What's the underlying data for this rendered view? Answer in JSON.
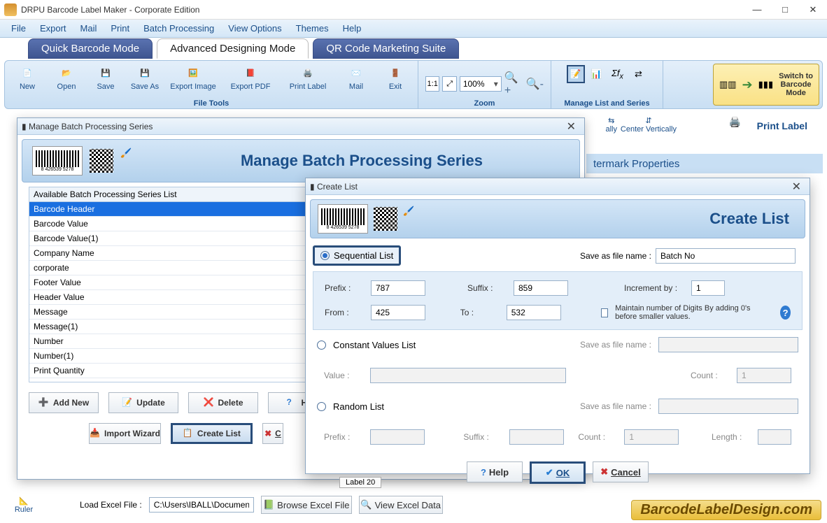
{
  "app": {
    "title": "DRPU Barcode Label Maker - Corporate Edition"
  },
  "menu": [
    "File",
    "Export",
    "Mail",
    "Print",
    "Batch Processing",
    "View Options",
    "Themes",
    "Help"
  ],
  "modes": {
    "quick": "Quick Barcode Mode",
    "advanced": "Advanced Designing Mode",
    "qr": "QR Code Marketing Suite"
  },
  "ribbon": {
    "file": {
      "new": "New",
      "open": "Open",
      "save": "Save",
      "saveas": "Save As",
      "exportimg": "Export Image",
      "exportpdf": "Export PDF",
      "printlabel": "Print Label",
      "mail": "Mail",
      "exit": "Exit",
      "caption": "File Tools"
    },
    "zoom": {
      "caption": "Zoom",
      "value": "100%"
    },
    "series": {
      "caption": "Manage List and Series"
    },
    "switch": {
      "line1": "Switch to",
      "line2": "Barcode",
      "line3": "Mode"
    },
    "center_v": "Center Vertically",
    "center_h_suffix": "ally",
    "print_label": "Print Label"
  },
  "props_strip": "termark Properties",
  "batch": {
    "title": "Manage Batch Processing Series",
    "header": "Manage Batch Processing Series",
    "list_header": "Available Batch Processing Series List",
    "items": [
      "Barcode Header",
      "Barcode Value",
      "Barcode Value(1)",
      "Company Name",
      "corporate",
      "Footer Value",
      "Header Value",
      "Message",
      "Message(1)",
      "Number",
      "Number(1)",
      "Print Quantity"
    ],
    "buttons": {
      "add": "Add New",
      "update": "Update",
      "delete": "Delete",
      "help": "Help",
      "import": "Import Wizard",
      "create": "Create List",
      "cancel_char": "C"
    }
  },
  "create": {
    "title": "Create List",
    "header": "Create List",
    "seq_label": "Sequential List",
    "save_label": "Save as file name :",
    "filename": "Batch No",
    "prefix_l": "Prefix :",
    "prefix": "787",
    "suffix_l": "Suffix :",
    "suffix": "859",
    "inc_l": "Increment by :",
    "inc": "1",
    "from_l": "From :",
    "from": "425",
    "to_l": "To :",
    "to": "532",
    "maintain": "Maintain number of Digits By adding 0's before smaller values.",
    "const_label": "Constant Values List",
    "value_l": "Value :",
    "count_l": "Count :",
    "count": "1",
    "rand_label": "Random List",
    "length_l": "Length :",
    "btn_help": "Help",
    "btn_ok": "OK",
    "btn_cancel": "Cancel"
  },
  "bottom": {
    "ruler": "Ruler",
    "load_excel": "Load Excel File :",
    "path": "C:\\Users\\IBALL\\Documen",
    "browse": "Browse Excel File",
    "view": "View Excel Data",
    "label_chip": "Label 20"
  },
  "brand": "BarcodeLabelDesign.com"
}
